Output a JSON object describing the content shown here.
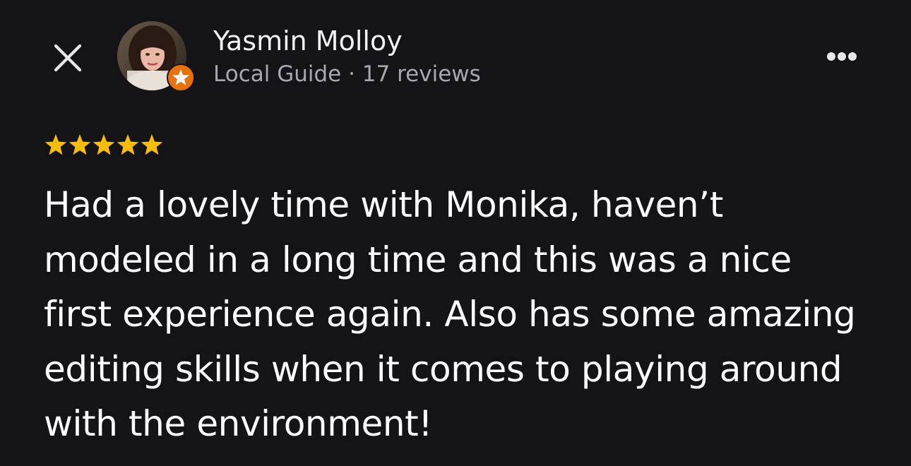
{
  "reviewer": {
    "name": "Yasmin Molloy",
    "meta": "Local Guide · 17 reviews"
  },
  "icons": {
    "close": "close-icon",
    "more": "more-horizontal-icon",
    "badge": "local-guide-star-icon",
    "star": "star-icon"
  },
  "review": {
    "rating": 5,
    "text": "Had a lovely time with Monika, haven’t modeled in a long time and this was a nice first experience again. Also has some amazing editing skills when it comes to playing around with the environment!"
  },
  "colors": {
    "background": "#141416",
    "star": "#fbbc04",
    "badge": "#e8710a",
    "secondary_text": "#a8a8ad"
  }
}
